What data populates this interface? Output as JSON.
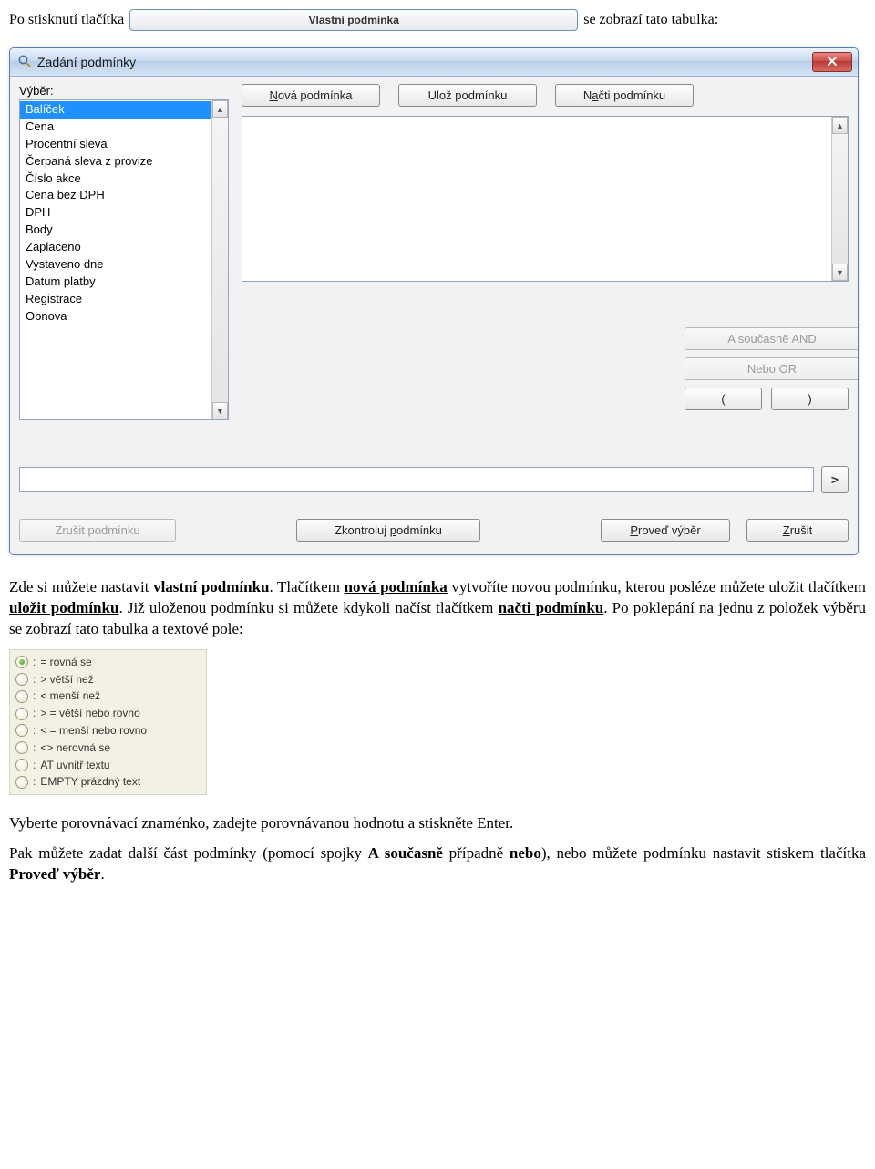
{
  "intro": {
    "before": "Po stisknutí tlačítka",
    "button": "Vlastní podmínka",
    "after": "se zobrazí tato tabulka:"
  },
  "dialog": {
    "title": "Zadání podmínky",
    "select_label": "Výběr:",
    "list": [
      "Balíček",
      "Cena",
      "Procentní sleva",
      "Čerpaná sleva z provize",
      "Číslo akce",
      "Cena bez DPH",
      "DPH",
      "Body",
      "Zaplaceno",
      "Vystaveno dne",
      "Datum platby",
      "Registrace",
      "Obnova"
    ],
    "buttons": {
      "new_full": "Nová podmínka",
      "new_u": "N",
      "new_rest": "ová podmínka",
      "save": "Ulož podmínku",
      "load_full": "Načti podmínku",
      "load_pre": "N",
      "load_u": "a",
      "load_rest": "čti podmínku",
      "and": "A současně AND",
      "or": "Nebo  OR",
      "lparen": "(",
      "rparen": ")",
      "go": ">",
      "cancel_cond": "Zrušit podmínku",
      "check_pre": "Zkontroluj ",
      "check_u": "p",
      "check_rest": "odmínku",
      "run_u": "P",
      "run_rest": "roveď výběr",
      "cancel_u": "Z",
      "cancel_rest": "rušit"
    }
  },
  "para1": {
    "t1": "Zde si můžete nastavit ",
    "b1": "vlastní podmínku",
    "t2": ". Tlačítkem ",
    "bu1": "nová podmínka",
    "t3": " vytvoříte novou podmínku, kterou posléze můžete uložit tlačítkem ",
    "bu2": "uložit podmínku",
    "t4": ". Již uloženou podmínku si můžete kdykoli načíst tlačítkem ",
    "bu3": "načti podmínku",
    "t5": ". Po poklepání na jednu z položek výběru se zobrazí tato tabulka a textové pole:"
  },
  "ops": [
    {
      "sel": true,
      "txt": "= rovná se"
    },
    {
      "sel": false,
      "txt": "> větší než"
    },
    {
      "sel": false,
      "txt": "< menší než"
    },
    {
      "sel": false,
      "txt": "> = větší nebo rovno"
    },
    {
      "sel": false,
      "txt": "< = menší nebo rovno"
    },
    {
      "sel": false,
      "txt": "<> nerovná se"
    },
    {
      "sel": false,
      "txt": "AT uvnitř textu"
    },
    {
      "sel": false,
      "txt": "EMPTY  prázdný text"
    }
  ],
  "para2": "Vyberte porovnávací znaménko, zadejte porovnávanou hodnotu a stiskněte Enter.",
  "para3": {
    "t1": "Pak můžete zadat další část podmínky (pomocí spojky ",
    "b1": "A současně",
    "t2": " případně ",
    "b2": "nebo",
    "t3": "), nebo můžete podmínku nastavit stiskem tlačítka ",
    "b3": "Proveď výběr",
    "t4": "."
  }
}
